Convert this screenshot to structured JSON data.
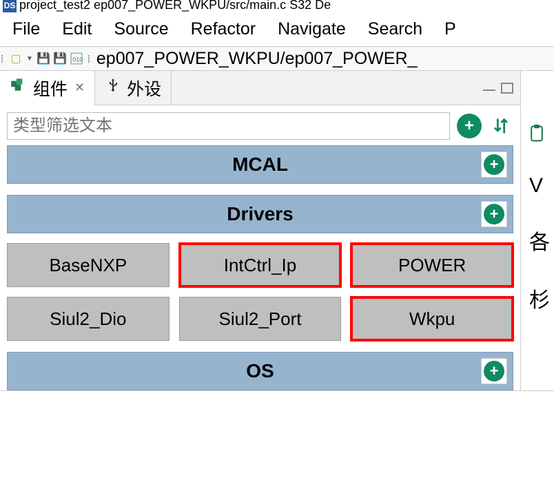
{
  "window": {
    "title_fragment": "project_test2    ep007_POWER_WKPU/src/main.c    S32 De"
  },
  "menu": {
    "file": "File",
    "edit": "Edit",
    "source": "Source",
    "refactor": "Refactor",
    "navigate": "Navigate",
    "search": "Search",
    "project_cut": "P"
  },
  "toolbar": {
    "path_fragment": "ep007_POWER_WKPU/ep007_POWER_"
  },
  "tabs": {
    "components": "组件",
    "peripherals": "外设"
  },
  "filter": {
    "placeholder": "类型筛选文本"
  },
  "sections": {
    "mcal": {
      "title": "MCAL"
    },
    "drivers": {
      "title": "Drivers",
      "items": [
        {
          "label": "BaseNXP",
          "hl": false
        },
        {
          "label": "IntCtrl_Ip",
          "hl": true
        },
        {
          "label": "POWER",
          "hl": true
        },
        {
          "label": "Siul2_Dio",
          "hl": false
        },
        {
          "label": "Siul2_Port",
          "hl": false
        },
        {
          "label": "Wkpu",
          "hl": true
        }
      ]
    },
    "os": {
      "title": "OS"
    }
  },
  "right_fragments": {
    "a": "V",
    "b": "各",
    "c": "杉"
  }
}
